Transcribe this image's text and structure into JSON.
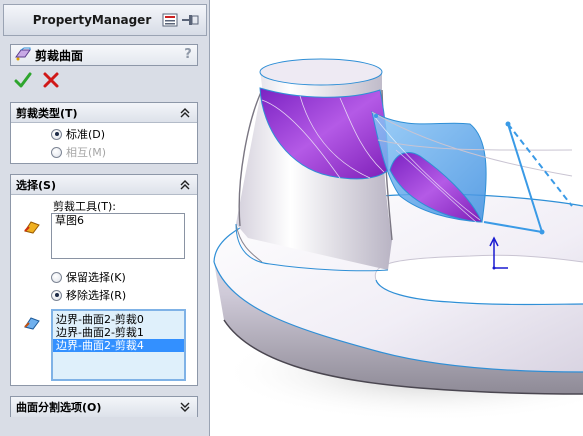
{
  "panel": {
    "title": "PropertyManager",
    "feature_name": "剪裁曲面",
    "help_label": "?",
    "ok_icon": "green-check-icon",
    "cancel_icon": "red-x-icon"
  },
  "trim_type": {
    "header": "剪裁类型(T)",
    "options": [
      {
        "label": "标准(D)",
        "selected": true,
        "enabled": true
      },
      {
        "label": "相互(M)",
        "selected": false,
        "enabled": false
      }
    ]
  },
  "selections": {
    "header": "选择(S)",
    "trim_tool_label": "剪裁工具(T):",
    "trim_tool_items": [
      "草图6"
    ],
    "keep_option": {
      "label": "保留选择(K)",
      "selected": false
    },
    "remove_option": {
      "label": "移除选择(R)",
      "selected": true
    },
    "face_items": [
      "边界-曲面2-剪裁0",
      "边界-曲面2-剪裁1",
      "边界-曲面2-剪裁4"
    ],
    "highlighted_index": 2
  },
  "split_options": {
    "header": "曲面分割选项(O)"
  },
  "colors": {
    "panel_bg": "#d9dde6",
    "highlight": "#3390ff",
    "purple_face": "#9933cc",
    "blue_face": "#4d9ee8",
    "edge": "#2f8fd6"
  }
}
